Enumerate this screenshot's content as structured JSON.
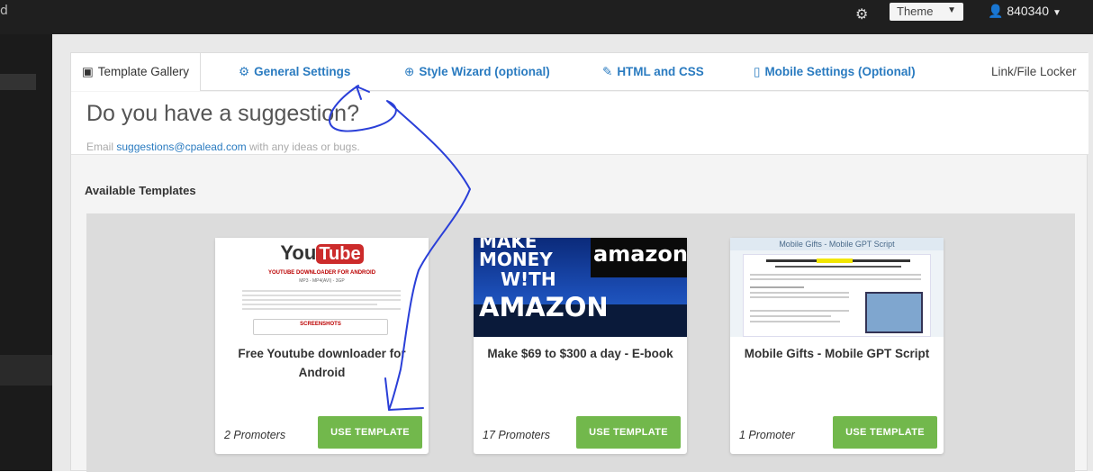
{
  "topbar": {
    "corner": "d",
    "theme": "Theme",
    "user": "840340"
  },
  "tabs": [
    {
      "label": "Template Gallery",
      "icon": "image-icon"
    },
    {
      "label": "General Settings",
      "icon": "gears-icon"
    },
    {
      "label": "Style Wizard (optional)",
      "icon": "plus-circle-icon"
    },
    {
      "label": "HTML and CSS",
      "icon": "pencil-icon"
    },
    {
      "label": "Mobile Settings (Optional)",
      "icon": "mobile-icon"
    },
    {
      "label": "Link/File Locker"
    }
  ],
  "suggestion": {
    "title": "Do you have a suggestion?",
    "prefix": "Email ",
    "email": "suggestions@cpalead.com",
    "suffix": " with any ideas or bugs."
  },
  "available_label": "Available Templates",
  "templates": [
    {
      "title": "Free Youtube downloader for Android",
      "promoters": "2 Promoters",
      "button": "USE TEMPLATE",
      "thumb": {
        "logo_a": "You",
        "logo_b": "Tube",
        "heading": "YOUTUBE DOWNLOADER FOR ANDROID",
        "formats": "MP3 - MP4(AVI) - 3GP",
        "screens": "SCREENSHOTS"
      }
    },
    {
      "title": "Make $69 to $300 a day - E-book",
      "promoters": "17 Promoters",
      "button": "USE TEMPLATE",
      "thumb": {
        "line1": "MAKE",
        "line2": "MONEY",
        "line3": "W!TH",
        "line4": "AMAZON",
        "brand": "amazon"
      }
    },
    {
      "title": "Mobile Gifts - Mobile GPT Script",
      "promoters": "1 Promoter",
      "button": "USE TEMPLATE",
      "thumb": {
        "heading": "Mobile Gifts - Mobile GPT Script"
      }
    }
  ],
  "colors": {
    "link": "#2a7bc0",
    "button": "#72b84c",
    "topbar": "#1f1f1f"
  }
}
